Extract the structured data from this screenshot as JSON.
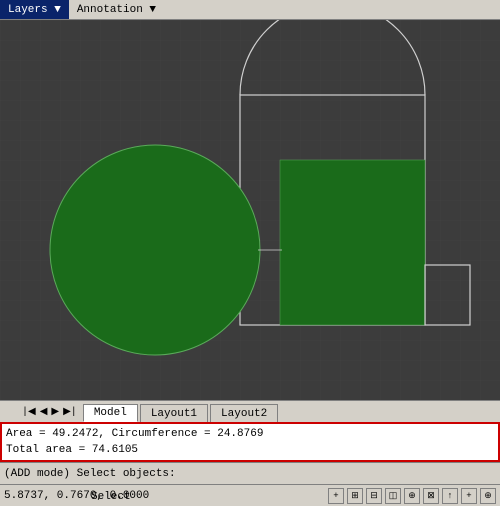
{
  "menubar": {
    "items": [
      "Layers ▼",
      "Annotation ▼"
    ]
  },
  "tabs": {
    "items": [
      {
        "label": "Model",
        "active": true
      },
      {
        "label": "Layout1",
        "active": false
      },
      {
        "label": "Layout2",
        "active": false
      }
    ]
  },
  "command_output": {
    "line1": "Area = 49.2472, Circumference = 24.8769",
    "line2": "Total area = 74.6105"
  },
  "status": {
    "mode_label": "(ADD mode) Select objects:",
    "coords": "5.8737, 0.7670, 0.0000",
    "select_label": "Select"
  },
  "statusbar_buttons": [
    "+",
    "⊞",
    "⊟",
    "◫",
    "⊕",
    "⊠",
    "↑",
    "+",
    "⊕"
  ],
  "shapes": {
    "circle": {
      "color": "#1a6b1a",
      "border": "#4a9a4a"
    },
    "rectangle": {
      "color": "#1a6b1a",
      "border": "#cccccc"
    },
    "outline": {
      "color": "transparent",
      "border": "#d0d0d0"
    }
  }
}
